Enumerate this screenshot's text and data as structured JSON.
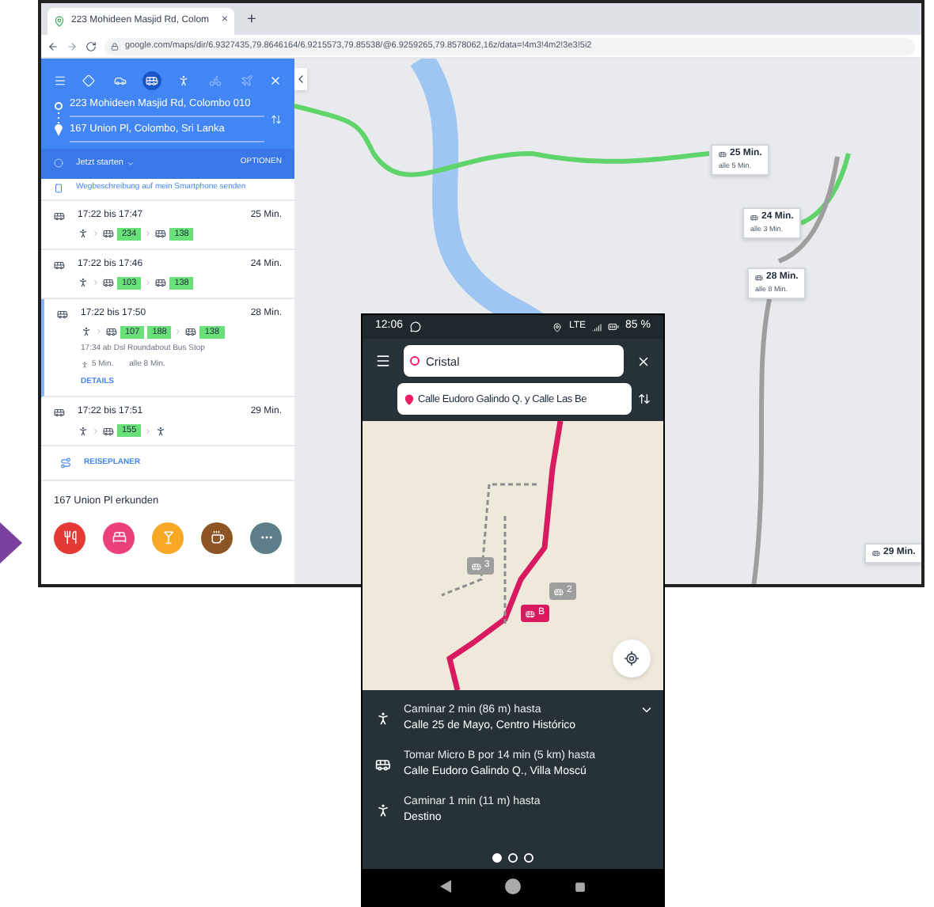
{
  "browser": {
    "tab": {
      "title": "223 Mohideen Masjid Rd, Colom",
      "close": "×"
    },
    "new_tab": "+",
    "url": "google.com/maps/dir/6.9327435,79.8646164/6.9215573,79.85538/@6.9259265,79.8578062,16z/data=!4m3!4m2!3e3!5i2"
  },
  "panel": {
    "modes": [
      {
        "kind": "directions",
        "selected": false,
        "disabled": false
      },
      {
        "kind": "car",
        "selected": false,
        "disabled": false
      },
      {
        "kind": "transit",
        "selected": true,
        "disabled": false
      },
      {
        "kind": "walk",
        "selected": false,
        "disabled": false
      },
      {
        "kind": "bike",
        "selected": false,
        "disabled": true
      },
      {
        "kind": "flight",
        "selected": false,
        "disabled": true
      }
    ],
    "origin": "223 Mohideen Masjid Rd, Colombo 010",
    "destination": "167 Union Pl, Colombo, Sri Lanka",
    "depart": "Jetzt starten",
    "options": "OPTIONEN",
    "send": "Wegbeschreibung auf mein Smartphone senden",
    "routes": [
      {
        "time": "17:22 bis 17:47",
        "duration": "25 Min.",
        "selected": false,
        "legs": [
          {
            "kind": "walk"
          },
          {
            "kind": "bus",
            "lines": [
              "234"
            ]
          },
          {
            "kind": "bus",
            "lines": [
              "138"
            ]
          }
        ]
      },
      {
        "time": "17:22 bis 17:46",
        "duration": "24 Min.",
        "selected": false,
        "legs": [
          {
            "kind": "walk"
          },
          {
            "kind": "bus",
            "lines": [
              "103"
            ]
          },
          {
            "kind": "bus",
            "lines": [
              "138"
            ]
          }
        ]
      },
      {
        "time": "17:22 bis 17:50",
        "duration": "28 Min.",
        "selected": true,
        "legs": [
          {
            "kind": "walk"
          },
          {
            "kind": "bus",
            "lines": [
              "107",
              "188"
            ]
          },
          {
            "kind": "bus",
            "lines": [
              "138"
            ]
          }
        ],
        "departure": "17:34 ab Dsl Roundabout Bus Stop",
        "walk": "5 Min.",
        "frequency": "alle 8 Min.",
        "details": "DETAILS"
      },
      {
        "time": "17:22 bis 17:51",
        "duration": "29 Min.",
        "selected": false,
        "legs": [
          {
            "kind": "walk"
          },
          {
            "kind": "bus",
            "lines": [
              "155"
            ]
          },
          {
            "kind": "walk"
          }
        ]
      }
    ],
    "planner": "REISEPLANER",
    "explore": "167 Union Pl erkunden",
    "categories": [
      {
        "kind": "restaurant",
        "color": "#e53935"
      },
      {
        "kind": "hotel",
        "color": "#ec407a"
      },
      {
        "kind": "bar",
        "color": "#f9a825"
      },
      {
        "kind": "cafe",
        "color": "#8d5524"
      },
      {
        "kind": "more",
        "color": "#607d8b"
      }
    ]
  },
  "map": {
    "callouts": [
      {
        "duration": "25 Min.",
        "frequency": "alle 5 Min."
      },
      {
        "duration": "24 Min.",
        "frequency": "alle 3 Min."
      },
      {
        "duration": "28 Min.",
        "frequency": "alle 8 Min."
      },
      {
        "duration": "29 Min."
      }
    ]
  },
  "phone": {
    "status": {
      "time": "12:06",
      "network": "LTE",
      "battery": "85 %"
    },
    "origin": "Cristal",
    "destination": "Calle Eudoro Galindo Q. y Calle Las Be",
    "markers": [
      {
        "kind": "bus",
        "label": "3"
      },
      {
        "kind": "bus",
        "label": "2"
      },
      {
        "kind": "line",
        "label": "B"
      }
    ],
    "steps": [
      {
        "kind": "walk",
        "line1": "Caminar 2 min (86 m) hasta",
        "line2": "Calle 25 de Mayo, Centro Histórico"
      },
      {
        "kind": "bus",
        "line1": "Tomar Micro B por 14 min (5 km) hasta",
        "line2": "Calle Eudoro Galindo Q., Villa Moscú"
      },
      {
        "kind": "walk",
        "line1": "Caminar 1 min (11 m) hasta",
        "line2": "Destino"
      }
    ],
    "pages": [
      {
        "selected": true
      },
      {
        "selected": false
      },
      {
        "selected": false
      }
    ]
  }
}
